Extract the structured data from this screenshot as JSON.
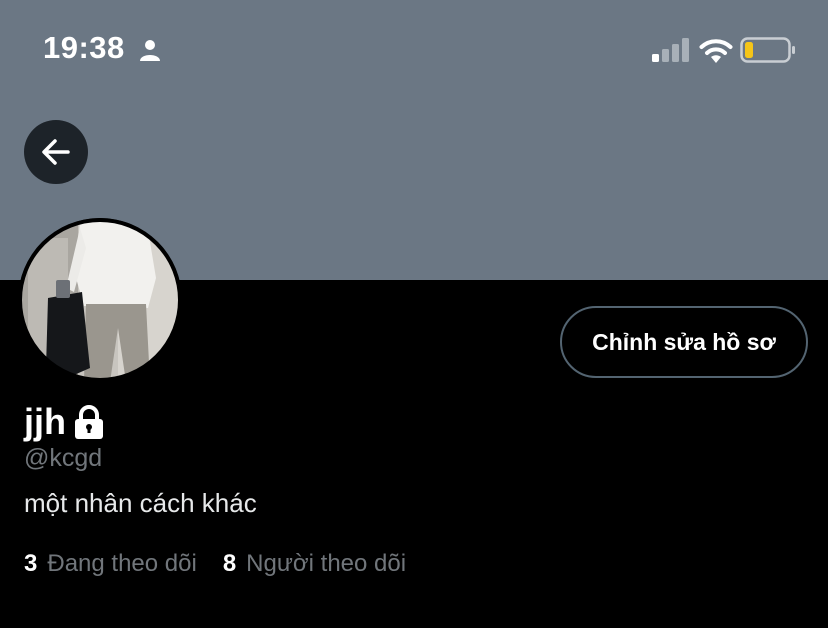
{
  "status_bar": {
    "time": "19:38",
    "icons": [
      "person-icon",
      "cellular-signal-icon",
      "wifi-icon",
      "battery-low-icon"
    ],
    "battery_color": "#f5c518"
  },
  "header": {
    "back_icon": "arrow-left-icon",
    "banner_color": "#6b7784"
  },
  "profile": {
    "display_name": "jjh",
    "protected_icon": "lock-icon",
    "handle": "@kcgd",
    "bio": "một nhân cách khác",
    "edit_button_label": "Chỉnh sửa hồ sơ"
  },
  "stats": {
    "following_count": "3",
    "following_label": "Đang theo dõi",
    "followers_count": "8",
    "followers_label": "Người theo dõi"
  },
  "colors": {
    "background": "#000000",
    "muted_text": "#71767b",
    "button_border": "#536471"
  }
}
